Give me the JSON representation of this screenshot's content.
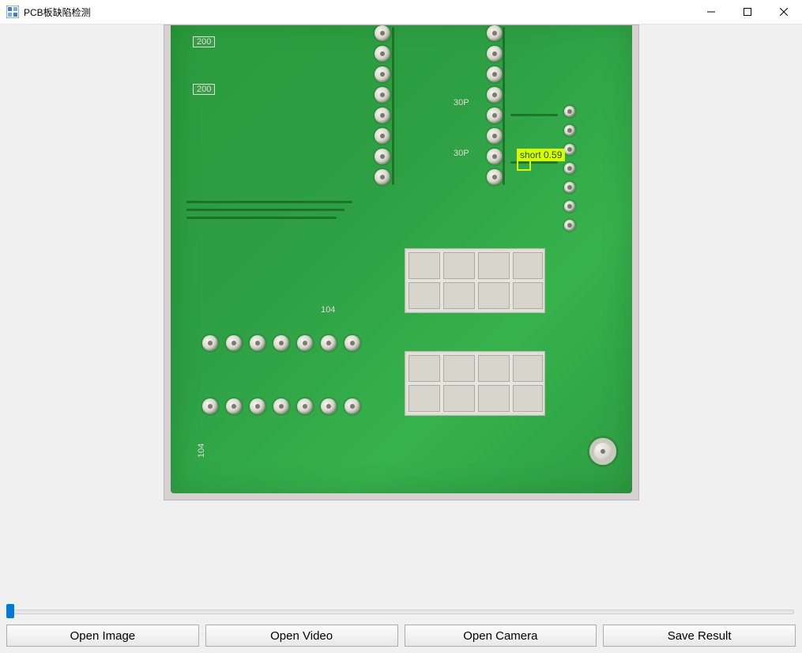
{
  "window": {
    "title": "PCB板缺陷检测"
  },
  "detection": {
    "label": "short 0.59"
  },
  "silkscreen": {
    "r200a": "200",
    "r200b": "200",
    "c30pa": "30P",
    "c30pb": "30P",
    "p104a": "104",
    "p104b": "104"
  },
  "slider": {
    "value_percent": 0
  },
  "buttons": {
    "open_image": "Open Image",
    "open_video": "Open Video",
    "open_camera": "Open Camera",
    "save_result": "Save Result"
  }
}
